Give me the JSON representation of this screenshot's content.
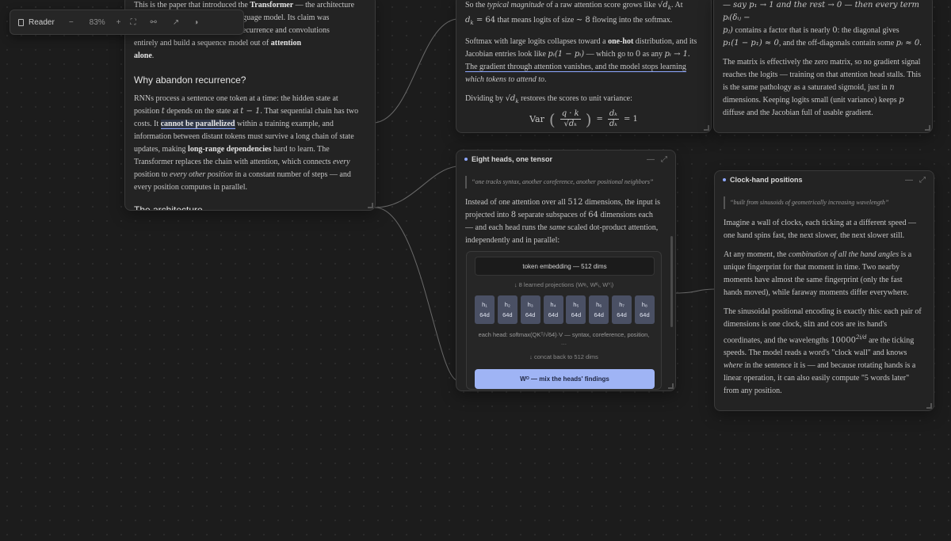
{
  "toolbar": {
    "reader_label": "Reader",
    "zoom_out": "−",
    "zoom_value": "83%",
    "zoom_in": "+",
    "fit_icon": "⛶",
    "tree_icon": "⚯",
    "open_icon": "↗",
    "theme_icon": "◑"
  },
  "left_card": {
    "intro_a": "This is the paper that introduced the ",
    "intro_b": "Transformer",
    "intro_c": " — the architecture",
    "intro_line2": "rge language model. Its claim was",
    "intro_line3": "away recurrence and convolutions",
    "intro_line4a": "entirely and build a sequence model out of ",
    "intro_line4b": "attention",
    "intro_line5a": "alone",
    "intro_line5b": ".",
    "section_title": "Why abandon recurrence?",
    "p1": "RNNs process a sentence one token at a time: the hidden state at",
    "p2a": "position ",
    "p2_t": "t",
    "p2b": " depends on the state at ",
    "p2_t1": "t − 1",
    "p2c": ". That sequential chain has two",
    "p3a": "costs. It ",
    "p3_hl": "cannot be parallelized",
    "p3b": " within a training example, and",
    "p4": "information between distant tokens must survive a long chain of state",
    "p5a": "updates, making ",
    "p5_b": "long-range dependencies",
    "p5c": " hard to learn. The",
    "p6a": "Transformer replaces the chain with attention, which connects ",
    "p6_i": "every",
    "p7a": "position to ",
    "p7_i": "every other position",
    "p7b": " in a constant number of steps — and",
    "p8": "every position computes in parallel.",
    "next_section": "The architecture"
  },
  "mid_top_card": {
    "l1a": "So the ",
    "l1_i": "typical magnitude",
    "l1b": " of a raw attention score grows like ",
    "l1_m": "√d",
    "l1_sub": "k",
    "l1c": ". At",
    "l2_m1": "d",
    "l2_sub": "k",
    "l2_m2": " = 64",
    "l2a": " that means logits of size ",
    "l2_m3": "∼ 8",
    "l2b": " flowing into the softmax.",
    "p2_l1a": "Softmax with large logits collapses toward a ",
    "p2_l1b": "one-hot",
    "p2_l1c": " distribution, and its",
    "p2_l2a": "Jacobian entries look like ",
    "p2_l2m": "pᵢ(1 − pᵢ)",
    "p2_l2b": " — which go to ",
    "p2_l2m2": "0",
    "p2_l2c": " as any ",
    "p2_l2m3": "pᵢ → 1",
    "p2_l2d": ".",
    "p2_l3": "The gradient through attention vanishes, and the model stops learning",
    "p2_l4a": "which tokens to attend to",
    "p2_l4b": ".",
    "p3a": "Dividing by ",
    "p3_m": "√d",
    "p3_sub": "k",
    "p3b": " restores the scores to unit variance:",
    "eq_var": "Var",
    "eq_num": "q · k",
    "eq_den": "√dₖ",
    "eq_num2": "dₖ",
    "eq_den2": "dₖ",
    "eq_eq": "=",
    "eq_one": "= 1"
  },
  "right_top_card": {
    "l0": "— say p₁ → 1 and the rest → 0 — then every term pᵢ(δᵢⱼ −",
    "l1a": "pⱼ)",
    "l1b": " contains a factor that is nearly ",
    "l1m": "0",
    "l1c": ": the diagonal gives",
    "l2m": "p₁(1 − p₁) ≈ 0",
    "l2a": ", and the off-diagonals contain some ",
    "l2m2": "pᵢ ≈ 0",
    "l2b": ".",
    "p2_1": "The matrix is effectively the zero matrix, so no gradient signal",
    "p2_2": "reaches the logits — training on that attention head stalls. This",
    "p2_3": "is the same pathology as a saturated sigmoid, just in ",
    "p2_3m": "n",
    "p2_4a": "dimensions. Keeping logits small (unit variance) keeps ",
    "p2_4m": "p",
    "p2_5": "diffuse and the Jacobian full of usable gradient."
  },
  "heads_card": {
    "title": "Eight heads, one tensor",
    "minimize": "—",
    "expand": "⤢",
    "quote": "“one tracks syntax, another coreference, another positional neighbors”",
    "p1a": "Instead of one attention over all ",
    "p1m": "512",
    "p1b": " dimensions, the input is",
    "p2a": "projected into ",
    "p2m": "8",
    "p2b": " separate subspaces of ",
    "p2m2": "64",
    "p2c": " dimensions each",
    "p3a": "— and each head runs the ",
    "p3i": "same",
    "p3b": " scaled dot-product attention,",
    "p4": "independently and in parallel:",
    "diagram": {
      "embedding": "token embedding — 512 dims",
      "projections": "↓  8 learned projections (Wᵠᵢ, Wᴷᵢ, Wⱽᵢ)",
      "heads": [
        {
          "name": "h₁",
          "dim": "64d"
        },
        {
          "name": "h₂",
          "dim": "64d"
        },
        {
          "name": "h₃",
          "dim": "64d"
        },
        {
          "name": "h₄",
          "dim": "64d"
        },
        {
          "name": "h₅",
          "dim": "64d"
        },
        {
          "name": "h₆",
          "dim": "64d"
        },
        {
          "name": "h₇",
          "dim": "64d"
        },
        {
          "name": "h₈",
          "dim": "64d"
        }
      ],
      "each_head": "each head: softmax(QKᵀ/√64)·V — syntax, coreference, position,",
      "ellipsis": "…",
      "concat": "↓  concat back to 512 dims",
      "wo": "Wᴼ — mix the heads' findings"
    }
  },
  "clock_card": {
    "title": "Clock-hand positions",
    "minimize": "—",
    "expand": "⤢",
    "quote": "“built from sinusoids of geometrically increasing wavelength”",
    "p1_1": "Imagine a wall of clocks, each ticking at a different speed —",
    "p1_2": "one hand spins fast, the next slower, the next slower still.",
    "p2_1a": "At any moment, the ",
    "p2_1i": "combination of all the hand angles",
    "p2_1b": " is a",
    "p2_2": "unique fingerprint for that moment in time. Two nearby",
    "p2_3": "moments have almost the same fingerprint (only the fast",
    "p2_4": "hands moved), while faraway moments differ everywhere.",
    "p3_1": "The sinusoidal positional encoding is exactly this: each pair of",
    "p3_2a": "dimensions is one clock, ",
    "p3_2m": "sin",
    "p3_2b": " and ",
    "p3_2m2": "cos",
    "p3_2c": " are its hand's",
    "p3_3a": "coordinates, and the wavelengths ",
    "p3_3m": "10000",
    "p3_3sup": "2i/d",
    "p3_3b": " are the ticking",
    "p3_4": "speeds. The model reads a word's \"clock wall\" and knows",
    "p3_5i": "where",
    "p3_5b": " in the sentence it is — and because rotating hands is a",
    "p3_6": "linear operation, it can also easily compute \"5 words later\"",
    "p3_7": "from any position."
  }
}
